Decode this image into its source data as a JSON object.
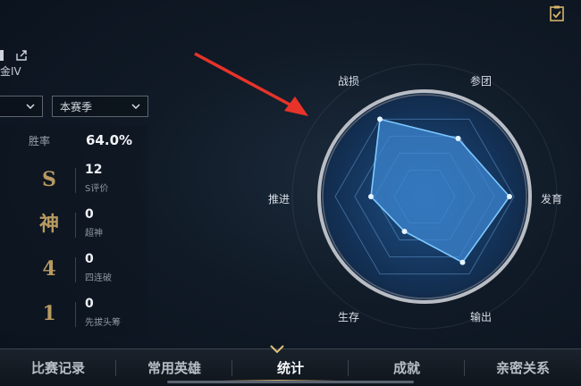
{
  "profile": {
    "rank": "金IV"
  },
  "filters": {
    "first_select_value": "",
    "season_select_value": "本赛季"
  },
  "stats": {
    "winrate_label": "胜率",
    "winrate_value": "64.0%",
    "blocks": [
      {
        "badge": "S",
        "value": "12",
        "label": "S评价"
      },
      {
        "badge": "神",
        "value": "0",
        "label": "超神"
      },
      {
        "badge": "4",
        "value": "0",
        "label": "四连破"
      },
      {
        "badge": "1",
        "value": "0",
        "label": "先拔头筹"
      }
    ]
  },
  "radar": {
    "axes": [
      "战损",
      "参团",
      "发育",
      "输出",
      "生存",
      "推进"
    ],
    "values": [
      1.0,
      0.75,
      0.95,
      0.85,
      0.45,
      0.6
    ],
    "fill_color": "#3c86d0",
    "stroke_color": "#7ec8ff"
  },
  "bottom_nav": {
    "tabs": [
      "比赛记录",
      "常用英雄",
      "统计",
      "成就",
      "亲密关系"
    ],
    "active_index": 2
  },
  "annotation": {
    "arrow_color": "#e8332a"
  }
}
